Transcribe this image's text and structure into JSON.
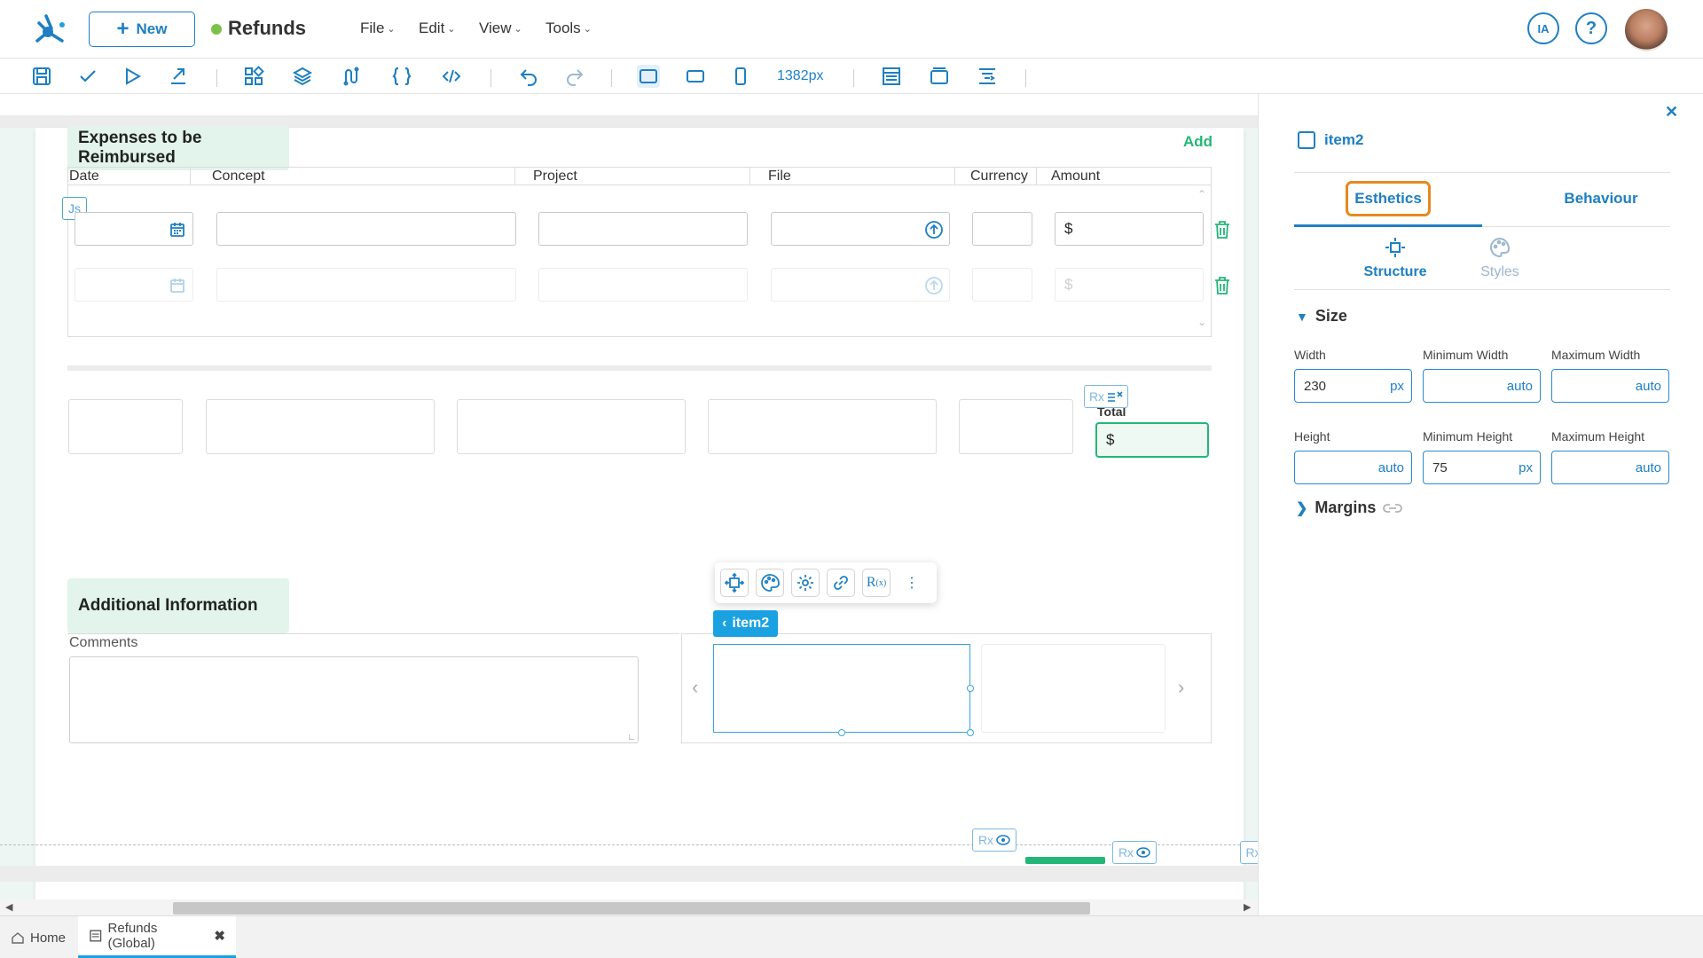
{
  "header": {
    "new_label": "New",
    "app_title": "Refunds",
    "menus": [
      "File",
      "Edit",
      "View",
      "Tools"
    ],
    "ia_label": "IA",
    "help_label": "?"
  },
  "toolbar": {
    "width_readout": "1382px"
  },
  "canvas": {
    "expenses_title": "Expenses to be Reimbursed",
    "add_label": "Add",
    "columns": [
      "Date",
      "Concept",
      "Project",
      "File",
      "Currency",
      "Amount"
    ],
    "js_badge": "Js",
    "currency_symbol": "$",
    "rx_label": "Rx",
    "total_label": "Total",
    "total_value": "$",
    "additional_title": "Additional Information",
    "comments_label": "Comments",
    "item_chip": "item2"
  },
  "panel": {
    "title": "item2",
    "tabs": [
      "Esthetics",
      "Behaviour"
    ],
    "subtabs": [
      "Structure",
      "Styles"
    ],
    "size_section": "Size",
    "margins_section": "Margins",
    "fields": {
      "width_label": "Width",
      "width_value": "230",
      "width_unit": "px",
      "minwidth_label": "Minimum Width",
      "minwidth_value": "auto",
      "maxwidth_label": "Maximum Width",
      "maxwidth_value": "auto",
      "height_label": "Height",
      "height_value": "auto",
      "minheight_label": "Minimum Height",
      "minheight_value": "75",
      "minheight_unit": "px",
      "maxheight_label": "Maximum Height",
      "maxheight_value": "auto"
    }
  },
  "bottom_tabs": {
    "home": "Home",
    "refunds": "Refunds (Global)"
  },
  "colors": {
    "accent": "#1e7fc2",
    "green": "#24b678",
    "highlight": "#e58a1e"
  }
}
